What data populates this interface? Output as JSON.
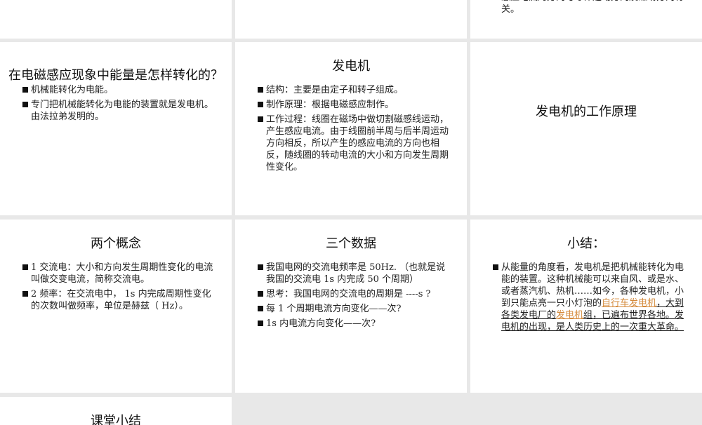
{
  "slides": [
    {
      "bullets": [
        "感应电流的方向与导体运动方向及磁场方向有关。"
      ]
    },
    {
      "title": "在电磁感应现象中能量是怎样转化的？",
      "bullets": [
        "机械能转化为电能。",
        "专门把机械能转化为电能的装置就是发电机。由法拉弟发明的。"
      ]
    },
    {
      "title": "发电机",
      "bullets": [
        "结构：主要是由定子和转子组成。",
        "制作原理：根据电磁感应制作。",
        "工作过程：线圈在磁场中做切割磁感线运动，产生感应电流。由于线圈前半周与后半周运动方向相反，所以产生的感应电流的方向也相反，随线圈的转动电流的大小和方向发生周期性变化。"
      ]
    },
    {
      "title": "发电机的工作原理"
    },
    {
      "title": "两个概念",
      "bullets": [
        "1  交流电：大小和方向发生周期性变化的电流叫做交变电流，简称交流电。",
        "2  频率：在交流电中， 1s 内完成周期性变化的次数叫做频率，单位是赫兹（ Hz）。"
      ]
    },
    {
      "title": "三个数据",
      "bullets": [
        "我国电网的交流电频率是 50Hz. （也就是说我国的交流电 1s 内完成 50 个周期）",
        "思考：我国电网的交流电的周期是 ----s ?",
        "每 1 个周期电流方向变化——次?",
        "1s 内电流方向变化——次?"
      ]
    },
    {
      "title": "小结：",
      "summary": {
        "part1": "从能量的角度看，发电机是把机械能转化为电能的装置。这种机械能可以来自风、或是水、或者蒸汽机、热机……如今，各种发电机，小到只能点亮一只小灯泡的",
        "link1": "自行车发电机",
        "part2": "，大到各类发电厂的",
        "link2": "发电机",
        "part3": "组，已遍布世界各地。发电机的出现，是人类历史上的一次重大革命。"
      }
    },
    {
      "title": "课堂小结"
    }
  ],
  "colors": {
    "link": "#d4893a",
    "background": "#e8e8e8"
  }
}
